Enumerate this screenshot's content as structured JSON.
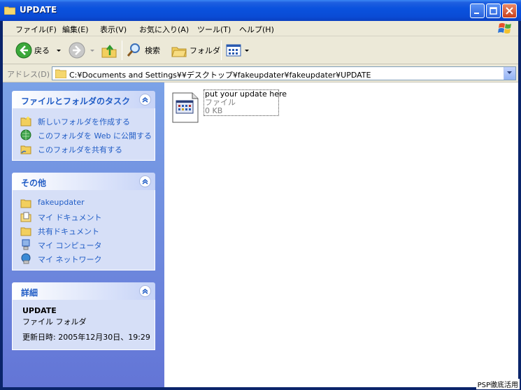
{
  "window": {
    "title": "UPDATE"
  },
  "menu": {
    "items": [
      "ファイル(F)",
      "編集(E)",
      "表示(V)",
      "お気に入り(A)",
      "ツール(T)",
      "ヘルプ(H)"
    ]
  },
  "toolbar": {
    "back_label": "戻る",
    "search_label": "検索",
    "folders_label": "フォルダ"
  },
  "address": {
    "label": "アドレス(D)",
    "value": "C:¥Documents and Settings¥¥デスクトップ¥fakeupdater¥fakeupdater¥UPDATE"
  },
  "tasks_panel": {
    "title": "ファイルとフォルダのタスク",
    "items": [
      {
        "label": "新しいフォルダを作成する",
        "icon": "new-folder-icon"
      },
      {
        "label": "このフォルダを Web に公開する",
        "icon": "web-publish-icon"
      },
      {
        "label": "このフォルダを共有する",
        "icon": "share-folder-icon"
      }
    ]
  },
  "other_panel": {
    "title": "その他",
    "items": [
      {
        "label": "fakeupdater",
        "icon": "folder-icon"
      },
      {
        "label": "マイ ドキュメント",
        "icon": "my-documents-icon"
      },
      {
        "label": "共有ドキュメント",
        "icon": "shared-documents-icon"
      },
      {
        "label": "マイ コンピュータ",
        "icon": "my-computer-icon"
      },
      {
        "label": "マイ ネットワーク",
        "icon": "my-network-icon"
      }
    ]
  },
  "details_panel": {
    "title": "詳細",
    "name": "UPDATE",
    "type": "ファイル フォルダ",
    "modified": "更新日時: 2005年12月30日、19:29"
  },
  "files": [
    {
      "name": "put your update here",
      "type": "ファイル",
      "size": "0 KB"
    }
  ],
  "watermark": "PSP徹底活用",
  "colors": {
    "titlebar": "#0a4bd5",
    "link": "#215dc6",
    "panel_body": "#d6dff7",
    "left_pane_top": "#7ba2e7"
  }
}
